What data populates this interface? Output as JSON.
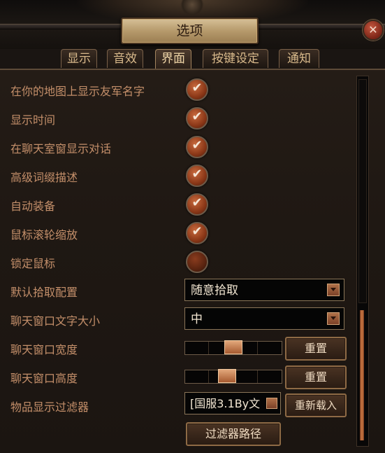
{
  "window": {
    "title": "选项",
    "close_icon": "close-icon"
  },
  "tabs": [
    {
      "label": "显示"
    },
    {
      "label": "音效"
    },
    {
      "label": "界面",
      "active": true
    },
    {
      "label": "按键设定"
    },
    {
      "label": "通知"
    }
  ],
  "settings": {
    "show_ally_names": {
      "label": "在你的地图上显示友军名字",
      "checked": true
    },
    "show_time": {
      "label": "显示时间",
      "checked": true
    },
    "chat_dialogue": {
      "label": "在聊天室窗显示对话",
      "checked": true
    },
    "advanced_mods": {
      "label": "高级词缀描述",
      "checked": true
    },
    "auto_equip": {
      "label": "自动装备",
      "checked": true
    },
    "mouse_wheel_zoom": {
      "label": "鼠标滚轮缩放",
      "checked": true
    },
    "lock_mouse": {
      "label": "锁定鼠标",
      "checked": false
    },
    "loot_config": {
      "label": "默认拾取配置",
      "value": "随意拾取"
    },
    "chat_font_size": {
      "label": "聊天窗口文字大小",
      "value": "中"
    },
    "chat_width": {
      "label": "聊天窗口宽度",
      "reset_label": "重置",
      "level": 0.5
    },
    "chat_height": {
      "label": "聊天窗口高度",
      "reset_label": "重置",
      "level": 0.42
    },
    "item_filter": {
      "label": "物品显示过滤器",
      "value": "[国服3.1By文",
      "reload_label": "重新载入",
      "path_label": "过滤器路径"
    }
  },
  "colors": {
    "label": "#c48f6a",
    "accent": "#d07a45",
    "panel": "#1f1813"
  }
}
